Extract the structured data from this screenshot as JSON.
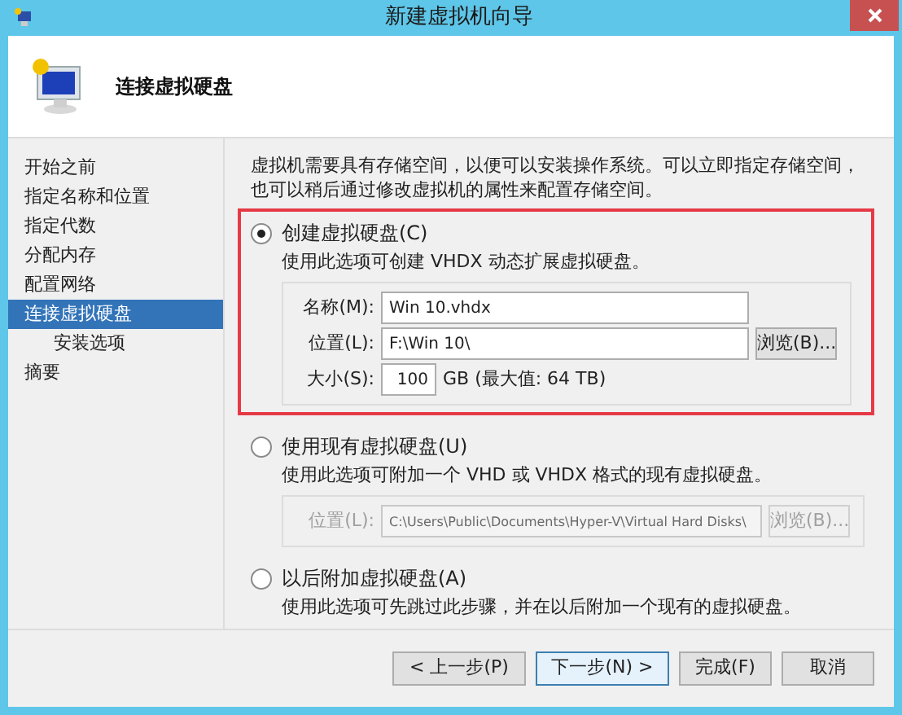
{
  "window": {
    "title": "新建虚拟机向导"
  },
  "header": {
    "title": "连接虚拟硬盘"
  },
  "sidebar": {
    "items": [
      {
        "label": "开始之前",
        "selected": false
      },
      {
        "label": "指定名称和位置",
        "selected": false
      },
      {
        "label": "指定代数",
        "selected": false
      },
      {
        "label": "分配内存",
        "selected": false
      },
      {
        "label": "配置网络",
        "selected": false
      },
      {
        "label": "连接虚拟硬盘",
        "selected": true,
        "children": [
          {
            "label": "安装选项",
            "selected": false
          }
        ]
      },
      {
        "label": "摘要",
        "selected": false
      }
    ]
  },
  "intro": "虚拟机需要具有存储空间，以便可以安装操作系统。可以立即指定存储空间，也可以稍后通过修改虚拟机的属性来配置存储空间。",
  "options": [
    {
      "label": "创建虚拟硬盘(C)",
      "selected": true,
      "description": "使用此选项可创建 VHDX 动态扩展虚拟硬盘。",
      "fields": [
        {
          "kind": "text",
          "label": "名称(M):",
          "value": "Win 10.vhdx",
          "disabled": false
        },
        {
          "kind": "browse",
          "label": "位置(L):",
          "value": "F:\\Win 10\\",
          "button": "浏览(B)...",
          "disabled": false
        },
        {
          "kind": "size",
          "label": "大小(S):",
          "value": "100",
          "suffix": "GB (最大值: 64 TB)",
          "disabled": false
        }
      ]
    },
    {
      "label": "使用现有虚拟硬盘(U)",
      "selected": false,
      "description": "使用此选项可附加一个 VHD 或 VHDX 格式的现有虚拟硬盘。",
      "fields": [
        {
          "kind": "browse",
          "label": "位置(L):",
          "value": "C:\\Users\\Public\\Documents\\Hyper-V\\Virtual Hard Disks\\",
          "button": "浏览(B)...",
          "disabled": true
        }
      ]
    },
    {
      "label": "以后附加虚拟硬盘(A)",
      "selected": false,
      "description": "使用此选项可先跳过此步骤，并在以后附加一个现有的虚拟硬盘。"
    }
  ],
  "buttons": [
    {
      "label": "< 上一步(P)",
      "default": false
    },
    {
      "label": "下一步(N) >",
      "default": true
    },
    {
      "label": "完成(F)",
      "default": false
    },
    {
      "label": "取消",
      "default": false
    }
  ]
}
